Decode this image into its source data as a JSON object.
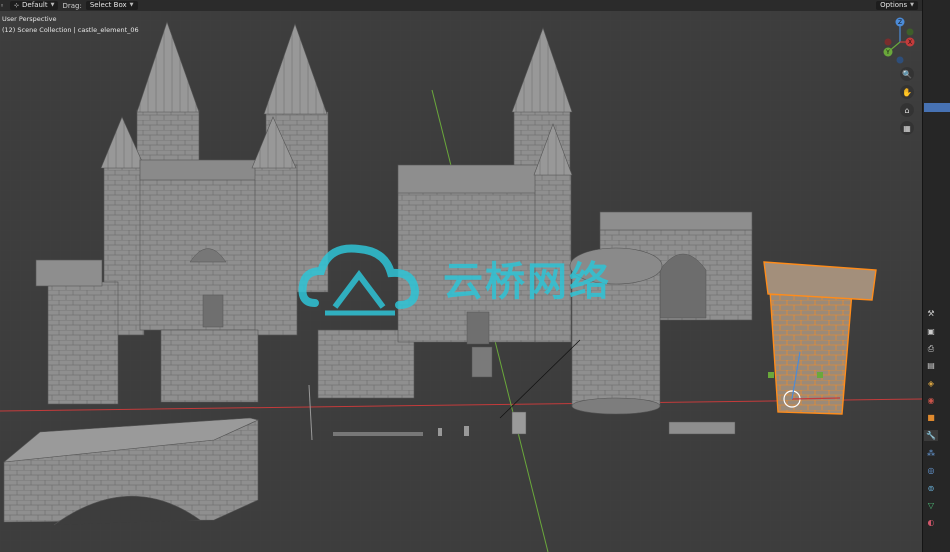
{
  "header": {
    "mode": "Default",
    "drag_label": "Drag:",
    "drag_value": "Select Box",
    "options": "Options"
  },
  "viewport": {
    "perspective": "User Perspective",
    "collection": "(12) Scene Collection | castle_element_06"
  },
  "gizmo": {
    "z": "Z",
    "y": "Y",
    "x": "X"
  },
  "watermark": {
    "text": "云桥网络"
  },
  "colors": {
    "viewport_bg": "#3d3d3d",
    "header_bg": "#2b2b2b",
    "selection": "#ff8c1a",
    "x_axis": "#c43b3b",
    "y_axis": "#6aa83b",
    "watermark": "#2ec4d6"
  },
  "icons": {
    "nav": [
      "zoom-icon",
      "hand-pan-icon",
      "camera-icon",
      "grid-icon"
    ],
    "properties": [
      "tool-icon",
      "render-icon",
      "output-icon",
      "view-layer-icon",
      "scene-icon",
      "world-icon",
      "object-icon",
      "modifier-icon",
      "particles-icon",
      "physics-icon",
      "constraints-icon",
      "data-icon",
      "material-icon"
    ]
  }
}
